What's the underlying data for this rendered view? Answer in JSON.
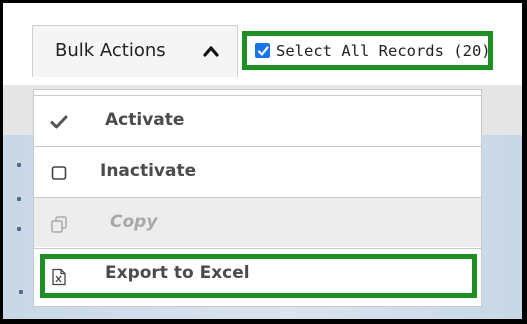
{
  "toolbar": {
    "bulk_actions_label": "Bulk Actions",
    "bulk_actions_icon": "chevron-up-icon",
    "select_all_label": "Select All Records (20)",
    "select_all_checked": true
  },
  "menu": {
    "items": [
      {
        "label": "Activate",
        "icon": "checkmark-icon",
        "enabled": true
      },
      {
        "label": "Inactivate",
        "icon": "checkbox-empty-icon",
        "enabled": true
      },
      {
        "label": "Copy",
        "icon": "copy-icon",
        "enabled": false
      },
      {
        "label": "Export to Excel",
        "icon": "excel-file-icon",
        "enabled": true
      }
    ]
  },
  "colors": {
    "highlight": "#1f8f23",
    "checkbox": "#1a73e8",
    "disabled_text": "#a8a8a8",
    "text": "#4b4b4b"
  }
}
